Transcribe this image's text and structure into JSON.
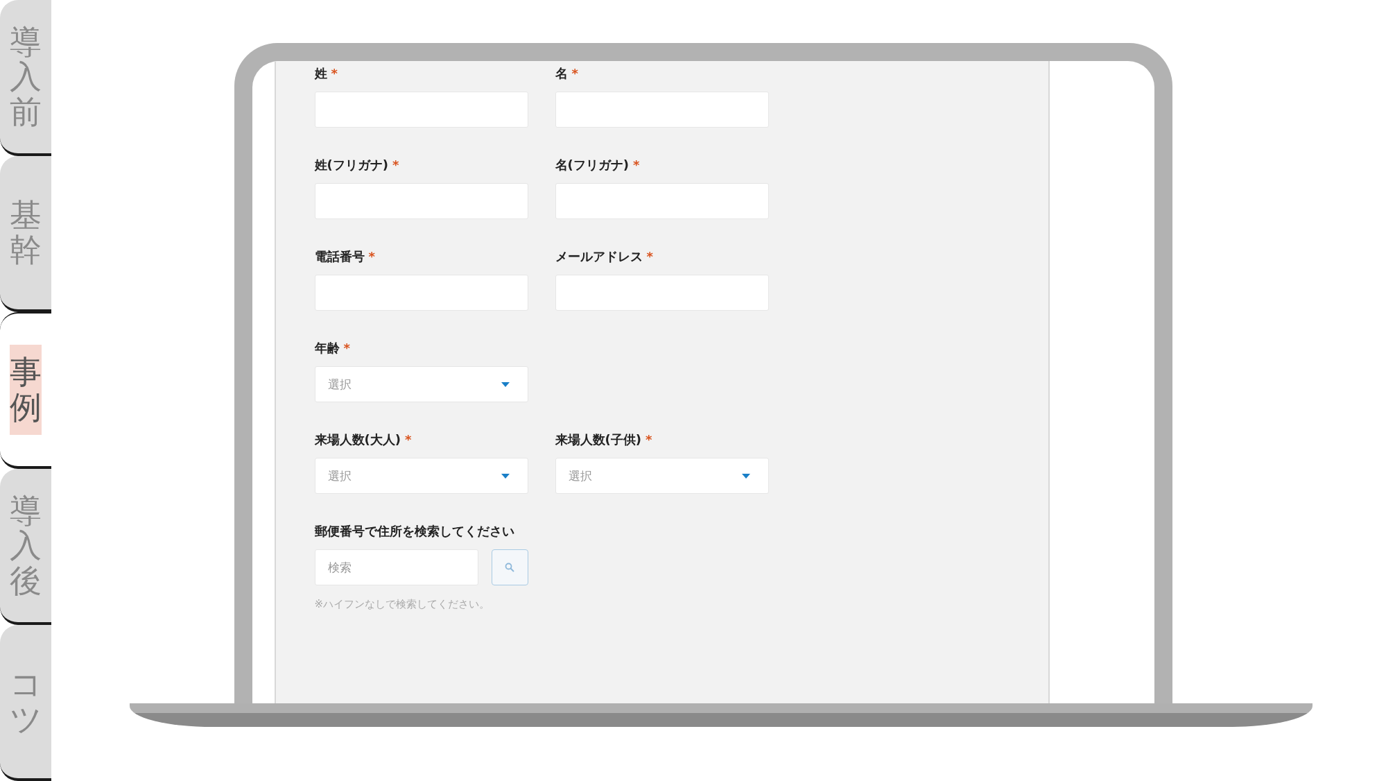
{
  "side_tabs": [
    {
      "label": "導入前",
      "selected": false
    },
    {
      "label": "基幹",
      "selected": false
    },
    {
      "label": "事例",
      "selected": true
    },
    {
      "label": "導入後",
      "selected": false
    },
    {
      "label": "コツ",
      "selected": false
    }
  ],
  "form": {
    "rows": [
      {
        "fields": [
          {
            "label": "姓",
            "required_mark": "*",
            "kind": "text"
          },
          {
            "label": "名",
            "required_mark": "*",
            "kind": "text"
          }
        ]
      },
      {
        "fields": [
          {
            "label": "姓(フリガナ)",
            "required_mark": "*",
            "kind": "text"
          },
          {
            "label": "名(フリガナ)",
            "required_mark": "*",
            "kind": "text"
          }
        ]
      },
      {
        "fields": [
          {
            "label": "電話番号",
            "required_mark": "*",
            "kind": "text"
          },
          {
            "label": "メールアドレス",
            "required_mark": "*",
            "kind": "text"
          }
        ]
      },
      {
        "fields": [
          {
            "label": "年齢",
            "required_mark": "*",
            "kind": "select",
            "placeholder": "選択"
          }
        ]
      },
      {
        "fields": [
          {
            "label": "来場人数(大人)",
            "required_mark": "*",
            "kind": "select",
            "placeholder": "選択"
          },
          {
            "label": "来場人数(子供)",
            "required_mark": "*",
            "kind": "select",
            "placeholder": "選択"
          }
        ]
      }
    ],
    "zip_search": {
      "label": "郵便番号で住所を検索してください",
      "placeholder": "検索",
      "note": "※ハイフンなしで検索してください。"
    }
  }
}
